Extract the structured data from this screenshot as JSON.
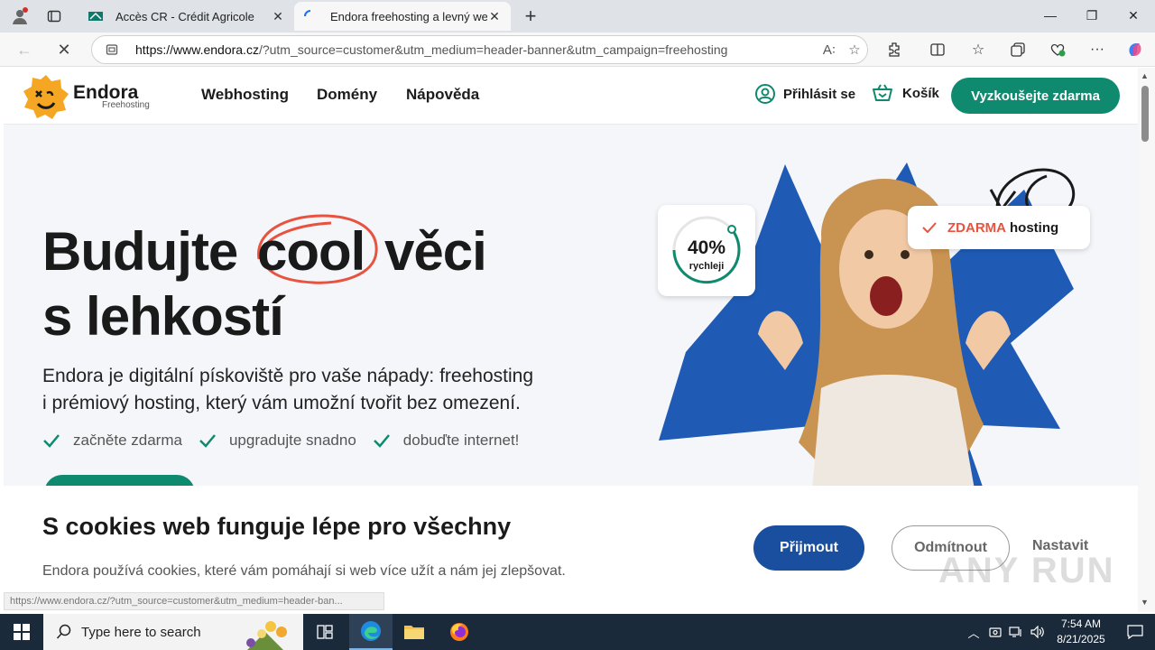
{
  "browser": {
    "tabs": [
      {
        "title": "Accès CR - Crédit Agricole",
        "active": false
      },
      {
        "title": "Endora freehosting a levný webhosting",
        "active": true
      }
    ],
    "new_tab": "+",
    "url_host": "https://www.endora.cz",
    "url_rest": "/?utm_source=customer&utm_medium=header-banner&utm_campaign=freehosting"
  },
  "site": {
    "logo_name": "Endora",
    "logo_sub": "Freehosting",
    "nav": [
      "Webhosting",
      "Domény",
      "Nápověda"
    ],
    "login": "Přihlásit se",
    "cart": "Košík",
    "cta": "Vyzkoušejte zdarma"
  },
  "hero": {
    "line1_a": "Budujte",
    "line1_b": "cool",
    "line1_c": "věci",
    "line2": "s lehkostí",
    "lead_1": "Endora je digitální pískoviště pro vaše nápady: freehosting",
    "lead_2": "i prémiový hosting, který vám umožní tvořit bez omezení.",
    "checks": [
      "začněte zdarma",
      "upgradujte snadno",
      "dobuďte internet!"
    ],
    "badge_num": "40%",
    "badge_label": "rychleji",
    "free_a": "ZDARMA",
    "free_b": "hosting"
  },
  "cookie": {
    "title": "S cookies web funguje lépe pro všechny",
    "text": "Endora používá cookies, které vám pomáhají si web více užít a nám jej zlepšovat.",
    "accept": "Přijmout",
    "deny": "Odmítnout",
    "settings": "Nastavit"
  },
  "status_url": "https://www.endora.cz/?utm_source=customer&utm_medium=header-ban...",
  "watermark": "ANY RUN",
  "taskbar": {
    "search_placeholder": "Type here to search",
    "time": "7:54 AM",
    "date": "8/21/2025"
  },
  "colors": {
    "brand_green": "#0f8a6f",
    "accent_red": "#e8533f",
    "accept_blue": "#1a4fa0",
    "hero_blue": "#1f5bb5"
  }
}
